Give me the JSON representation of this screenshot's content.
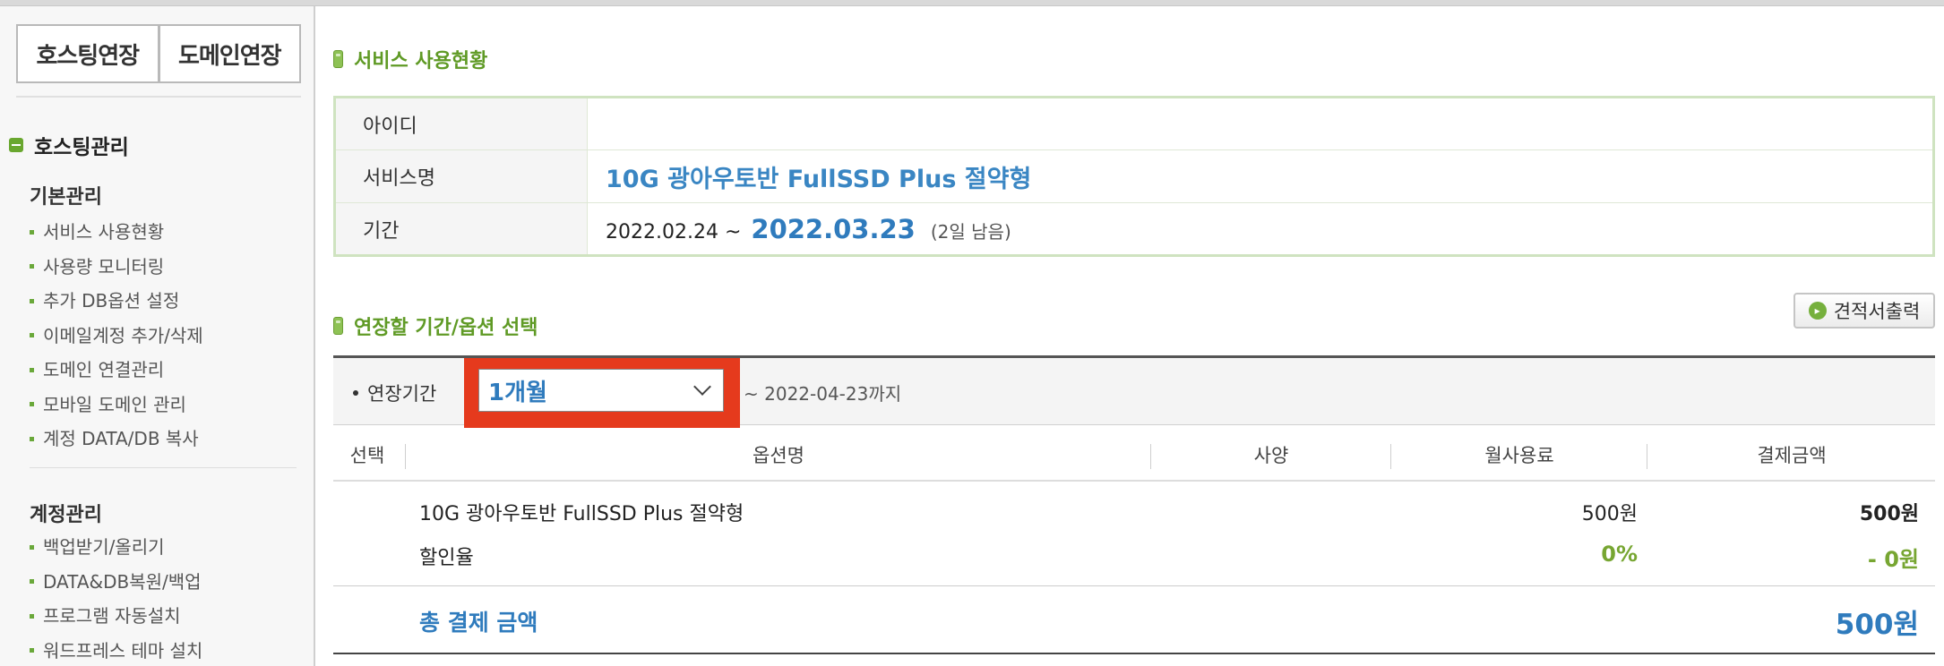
{
  "sidebar": {
    "extend_buttons": [
      "호스팅연장",
      "도메인연장"
    ],
    "section_title": "호스팅관리",
    "groups": [
      {
        "title": "기본관리",
        "items": [
          "서비스 사용현황",
          "사용량 모니터링",
          "추가 DB옵션 설정",
          "이메일계정 추가/삭제",
          "도메인 연결관리",
          "모바일 도메인 관리",
          "계정 DATA/DB 복사"
        ]
      },
      {
        "title": "계정관리",
        "items": [
          "백업받기/올리기",
          "DATA&DB복원/백업",
          "프로그램 자동설치",
          "워드프레스 테마 설치"
        ]
      }
    ]
  },
  "main": {
    "usage_title": "서비스 사용현황",
    "info": {
      "id_label": "아이디",
      "id_value": "",
      "service_label": "서비스명",
      "service_value": "10G 광아우토반 FullSSD Plus 절약형",
      "period_label": "기간",
      "start_date": "2022.02.24 ~",
      "end_date": "2022.03.23",
      "remaining": "(2일 남음)"
    },
    "extend_title": "연장할 기간/옵션 선택",
    "quote_button": "견적서출력",
    "period": {
      "label": "연장기간",
      "selected": "1개월",
      "until": "~ 2022-04-23까지"
    },
    "table": {
      "headers": [
        "선택",
        "옵션명",
        "사양",
        "월사용료",
        "결제금액"
      ],
      "rows": [
        {
          "name": "10G 광아우토반 FullSSD Plus 절약형",
          "monthly": "500원",
          "amount": "500원"
        },
        {
          "name": "할인율",
          "monthly": "0%",
          "amount": "- 0원"
        }
      ],
      "total_label": "총 결제 금액",
      "total_amount": "500원"
    }
  },
  "colors": {
    "accent_green": "#5f9a25",
    "accent_blue": "#2f7bbd",
    "highlight_red": "#e53a1d"
  }
}
